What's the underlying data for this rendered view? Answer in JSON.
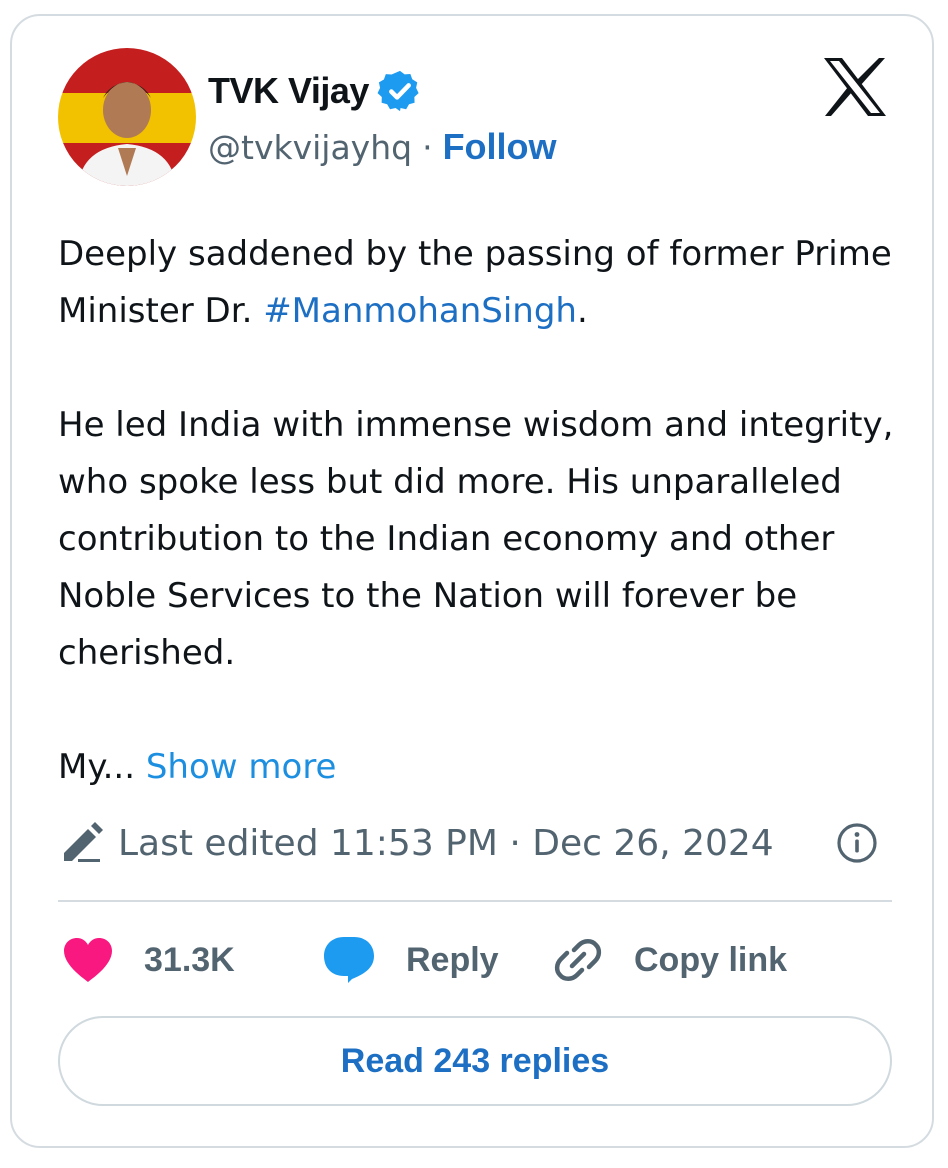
{
  "author": {
    "name": "TVK Vijay",
    "handle": "@tvkvijayhq",
    "separator": "·",
    "follow_label": "Follow",
    "verified": true,
    "avatar_colors": [
      "#c41e1e",
      "#f2c200"
    ]
  },
  "tweet": {
    "line1_prefix": "Deeply saddened by the passing of former Prime Minister Dr. ",
    "hashtag": "#ManmohanSingh",
    "line1_suffix": ".",
    "paragraph2": "He led India with immense wisdom and integrity, who spoke less but did more. His unparalleled contribution to the Indian economy and other Noble Services to the Nation will forever be cherished.",
    "truncated_text": "My...",
    "show_more_label": "Show more"
  },
  "meta": {
    "edited_label": "Last edited 11:53 PM · Dec 26, 2024"
  },
  "actions": {
    "like_count": "31.3K",
    "reply_label": "Reply",
    "copy_link_label": "Copy link"
  },
  "read_replies_label": "Read 243 replies",
  "colors": {
    "link": "#1d6fc4",
    "like": "#f91880",
    "reply_bubble": "#1d9bf0",
    "verified": "#1d9bf0"
  },
  "icons": {
    "verified": "verified-badge-icon",
    "brand": "x-logo-icon",
    "edit": "pencil-icon",
    "info": "info-icon",
    "like": "heart-icon",
    "reply": "speech-bubble-icon",
    "copy": "link-icon"
  }
}
